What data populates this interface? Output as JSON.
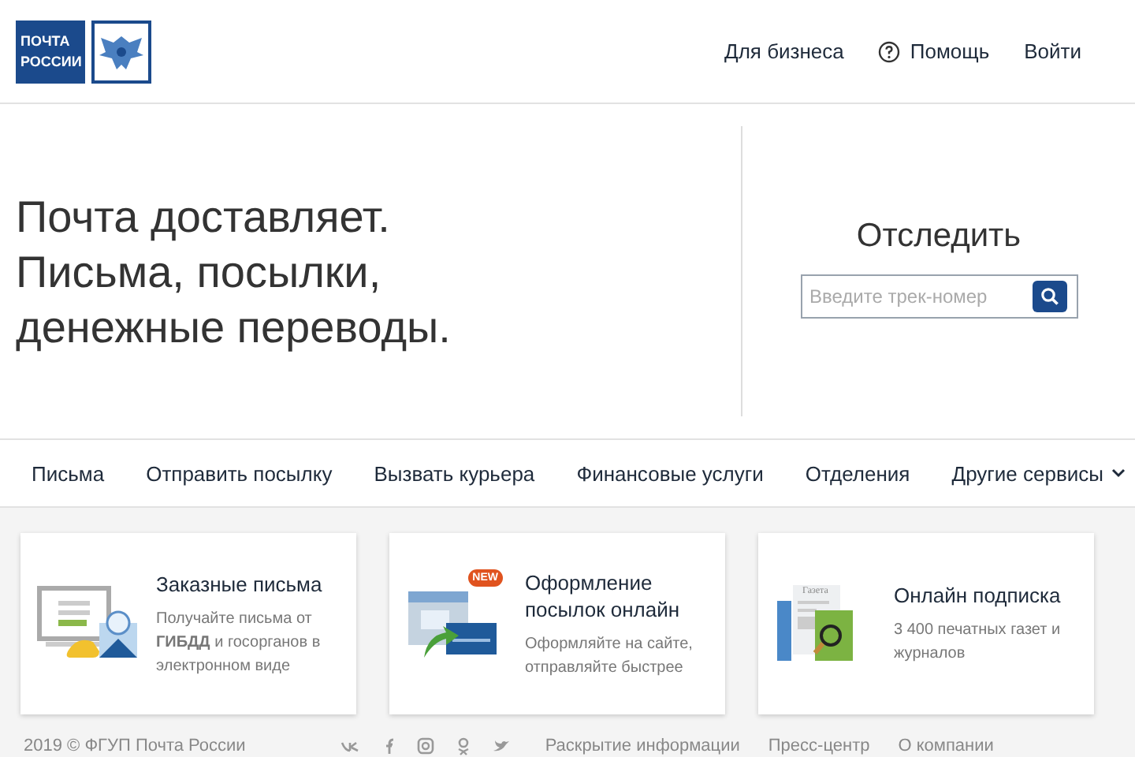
{
  "header": {
    "logo_text": [
      "ПОЧТА",
      "РОССИИ"
    ],
    "links": [
      {
        "label": "Для бизнеса",
        "kind": "plain"
      },
      {
        "label": "Помощь",
        "kind": "help"
      },
      {
        "label": "Войти",
        "kind": "plain"
      }
    ]
  },
  "hero": {
    "lines": [
      "Почта доставляет.",
      "Письма, посылки,",
      "денежные переводы."
    ]
  },
  "tracking": {
    "title": "Отследить",
    "placeholder": "Введите трек-номер"
  },
  "nav": [
    {
      "label": "Письма",
      "dropdown": false
    },
    {
      "label": "Отправить посылку",
      "dropdown": false
    },
    {
      "label": "Вызвать курьера",
      "dropdown": false
    },
    {
      "label": "Финансовые услуги",
      "dropdown": false
    },
    {
      "label": "Отделения",
      "dropdown": false
    },
    {
      "label": "Другие сервисы",
      "dropdown": true
    }
  ],
  "cards": [
    {
      "kind": "letters",
      "title": "Заказные письма",
      "description": "Получайте письма от **ГИБДД** и госорганов в электронном виде"
    },
    {
      "kind": "parcels",
      "title": "Оформление посылок онлайн",
      "description": "Оформляйте на сайте, отправляйте быстрее",
      "badge": "NEW"
    },
    {
      "kind": "subscription",
      "title": "Онлайн подписка",
      "description": "3 400 печатных газет и журналов",
      "paper_label": "Газета"
    }
  ],
  "footer": {
    "copyright": "2019 © ФГУП Почта России",
    "social": [
      {
        "kind": "vk"
      },
      {
        "kind": "facebook"
      },
      {
        "kind": "instagram"
      },
      {
        "kind": "odnoklassniki"
      },
      {
        "kind": "twitter"
      }
    ],
    "links": [
      "Раскрытие информации",
      "Пресс-центр",
      "О компании"
    ]
  }
}
